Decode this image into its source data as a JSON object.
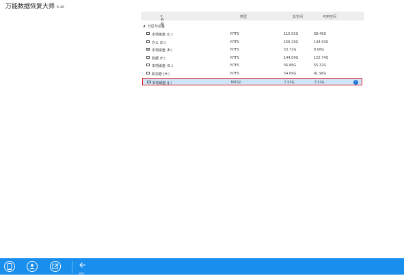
{
  "app": {
    "title": "万能数据恢复大师",
    "version": "6.46"
  },
  "table": {
    "headers": {
      "name": "名称",
      "type": "类型",
      "size": "总空间",
      "available": "可用空间"
    },
    "group_label": "分区与设备",
    "rows": [
      {
        "label": "本地磁盘 (C:)",
        "type": "NTFS",
        "size": "110.92G",
        "available": "68.46G",
        "icon": "drive-icon",
        "selected": false
      },
      {
        "label": "办公 (D:)",
        "type": "NTFS",
        "size": "156.29G",
        "available": "144.93G",
        "icon": "drive-icon",
        "selected": false
      },
      {
        "label": "本地磁盘 (E:)",
        "type": "NTFS",
        "size": "53.71G",
        "available": "8.06G",
        "icon": "drive-striped-icon",
        "selected": false
      },
      {
        "label": "数据 (F:)",
        "type": "NTFS",
        "size": "144.09G",
        "available": "122.74G",
        "icon": "drive-icon",
        "selected": false
      },
      {
        "label": "本地磁盘 (G:)",
        "type": "NTFS",
        "size": "56.88G",
        "available": "55.32G",
        "icon": "drive-icon",
        "selected": false
      },
      {
        "label": "新加卷 (H:)",
        "type": "NTFS",
        "size": "54.69G",
        "available": "41.96G",
        "icon": "drive-icon",
        "selected": false
      },
      {
        "label": "本地磁盘 (J:)",
        "type": "FAT32",
        "size": "7.53G",
        "available": "7.53G",
        "icon": "usb-drive-icon",
        "selected": true
      }
    ]
  },
  "bottombar": {
    "back_label": "返回"
  },
  "colors": {
    "accent": "#1a8eec",
    "selection_fill": "#cfe4f7",
    "selection_border": "#e02020",
    "check": "#1b73d6"
  }
}
